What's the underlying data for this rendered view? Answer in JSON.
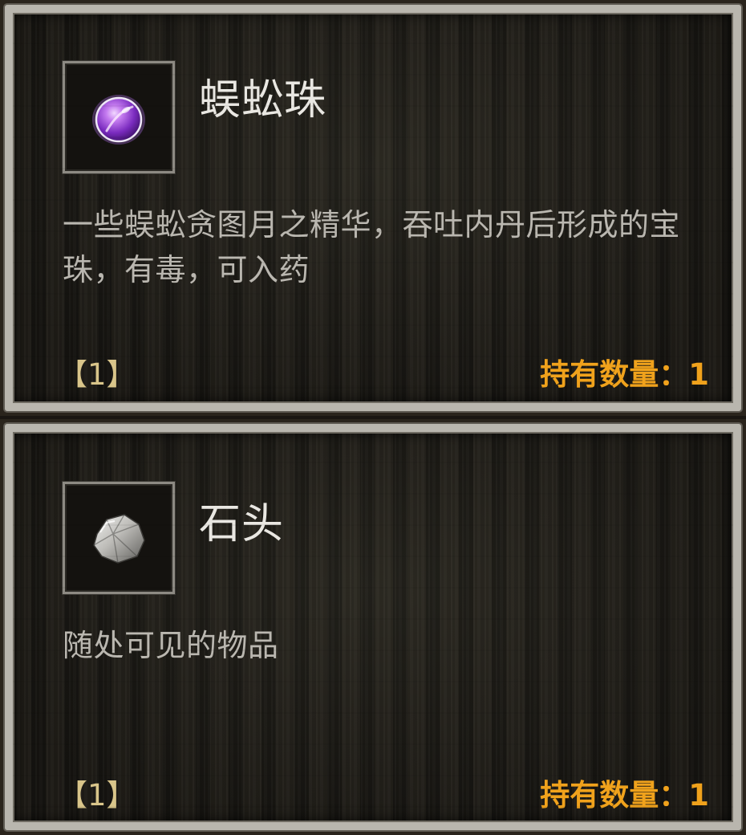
{
  "items": [
    {
      "name": "蜈蚣珠",
      "icon": "purple-gem-icon",
      "description": "一些蜈蚣贪图月之精华，吞吐内丹后形成的宝珠，有毒，可入药",
      "index": "【1】",
      "quantity_label": "持有数量：",
      "quantity": "1"
    },
    {
      "name": "石头",
      "icon": "stone-icon",
      "description": "随处可见的物品",
      "index": "【1】",
      "quantity_label": "持有数量：",
      "quantity": "1"
    }
  ],
  "colors": {
    "title": "#e9e7e2",
    "description": "#bab7b0",
    "index": "#d9c58a",
    "quantity": "#f0a21c",
    "frame": "#b9b6ae"
  }
}
